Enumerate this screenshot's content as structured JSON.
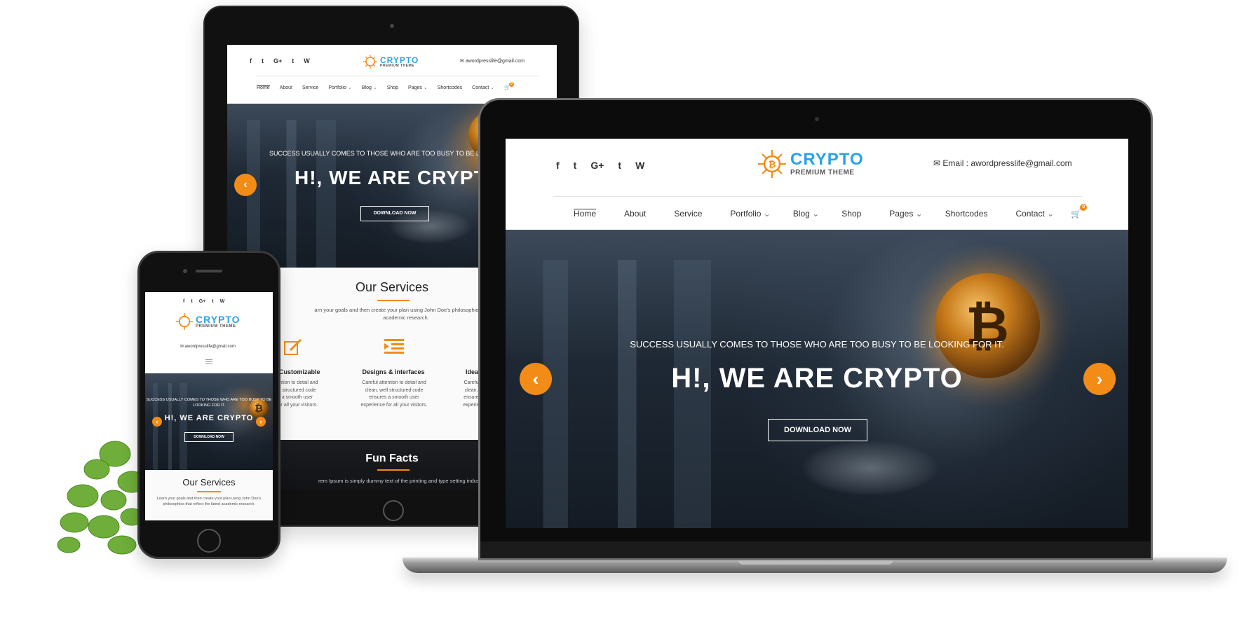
{
  "site": {
    "logo_word": "CRYPTO",
    "logo_sub": "PREMIUM THEME",
    "email_full": "Email : awordpresslife@gmail.com",
    "email_short": "awordpresslife@gmail.com",
    "social": [
      "f",
      "t",
      "G+",
      "t",
      "W"
    ],
    "nav": [
      "Home",
      "About",
      "Service",
      "Portfolio",
      "Blog",
      "Shop",
      "Pages",
      "Shortcodes",
      "Contact"
    ],
    "cart_count": "0",
    "hero_sub_desktop": "SUCCESS USUALLY COMES TO THOSE WHO ARE TOO BUSY TO BE LOOKING FOR IT.",
    "hero_sub_tablet": "SUCCESS USUALLY COMES TO THOSE WHO ARE TOO BUSY TO BE LOO",
    "hero_sub_phone_1": "SUCCESS USUALLY COMES TO THOSE WHO ARE TOO BUSY TO BE",
    "hero_sub_phone_2": "LOOKING FOR IT.",
    "hero_title": "H!, WE ARE CRYPTO",
    "hero_title_tablet": "H!, WE ARE CRYPT",
    "hero_button": "DOWNLOAD NOW",
    "services_title": "Our Services",
    "services_text_tablet_1": "arn your goals and then create your plan using John Doe's philosophies that re",
    "services_text_tablet_2": "academic research.",
    "services_text_phone": "Learn your goals and then create your plan using John Doe's philosophies that reflect the latest academic research.",
    "features": [
      {
        "title": "Customizable",
        "lines": [
          "ention to detail and",
          "ll structured code",
          "a smooth user",
          "for all your visitors."
        ]
      },
      {
        "title": "Designs & interfaces",
        "lines": [
          "Careful attention to detail and",
          "clean, well structured code",
          "ensures a smooth user",
          "experience for all your visitors."
        ]
      },
      {
        "title": "Idea",
        "lines": [
          "Carefu",
          "clean,",
          "ensure",
          "experie"
        ]
      }
    ],
    "fun_title": "Fun Facts",
    "fun_text": "rem Ipsum is simply dummy text of the printing and type setting industry. Lo"
  },
  "colors": {
    "accent": "#f28c16",
    "logo_blue": "#2aa3e6",
    "frame": "#111111"
  }
}
